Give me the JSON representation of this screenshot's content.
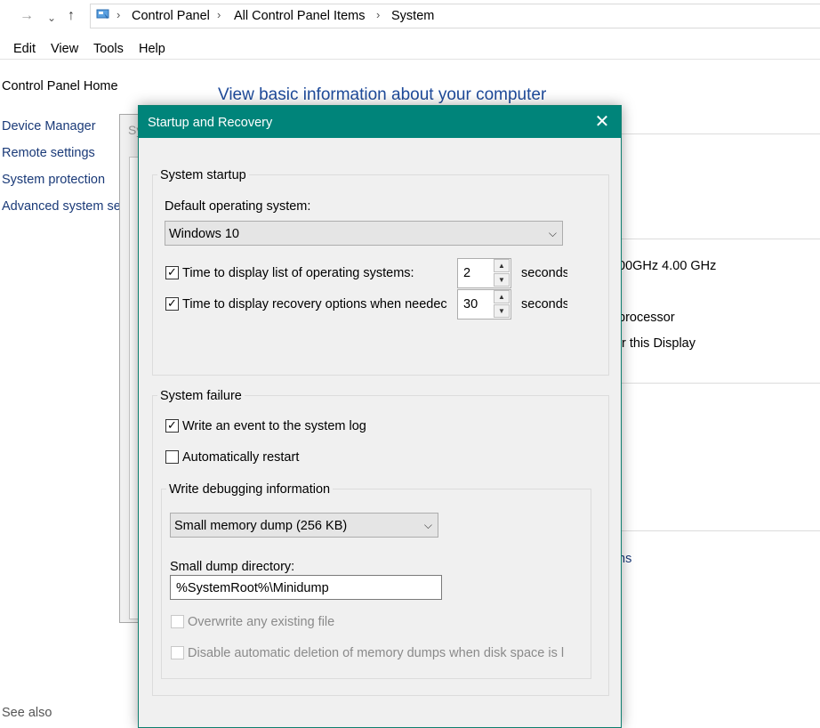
{
  "address": {
    "crumbs": [
      "Control Panel",
      "All Control Panel Items",
      "System"
    ]
  },
  "menu": [
    "Edit",
    "View",
    "Tools",
    "Help"
  ],
  "sidebar": {
    "home": "Control Panel Home",
    "items": [
      "Device Manager",
      "Remote settings",
      "System protection",
      "Advanced system se"
    ],
    "see_also": "See also"
  },
  "main": {
    "heading": "View basic information about your computer",
    "fragments": {
      "cpu_speed": "00GHz   4.00 GHz",
      "processor": "processor",
      "display": "r this Display",
      "link": "ns"
    }
  },
  "sysprops": {
    "title_fragment": "Sy"
  },
  "dialog": {
    "title": "Startup and Recovery",
    "startup": {
      "group_label": "System startup",
      "default_os_label": "Default operating system:",
      "default_os_value": "Windows 10",
      "time_list_label": "Time to display list of operating systems:",
      "time_list_value": "2",
      "time_recovery_label": "Time to display recovery options when needec",
      "time_recovery_value": "30",
      "seconds_label": "seconds"
    },
    "failure": {
      "group_label": "System failure",
      "write_event_label": "Write an event to the system log",
      "auto_restart_label": "Automatically restart",
      "debug_group_label": "Write debugging information",
      "dump_type_value": "Small memory dump (256 KB)",
      "dump_dir_label": "Small dump directory:",
      "dump_dir_value": "%SystemRoot%\\Minidump",
      "overwrite_label": "Overwrite any existing file",
      "disable_delete_label": "Disable automatic deletion of memory dumps when disk space is l"
    },
    "checks": {
      "time_list": true,
      "time_recovery": true,
      "write_event": true,
      "auto_restart": false,
      "overwrite": false,
      "disable_delete": false
    }
  },
  "colors": {
    "titlebar": "#00847a",
    "link": "#1a3a78",
    "heading": "#1e4a9a"
  }
}
